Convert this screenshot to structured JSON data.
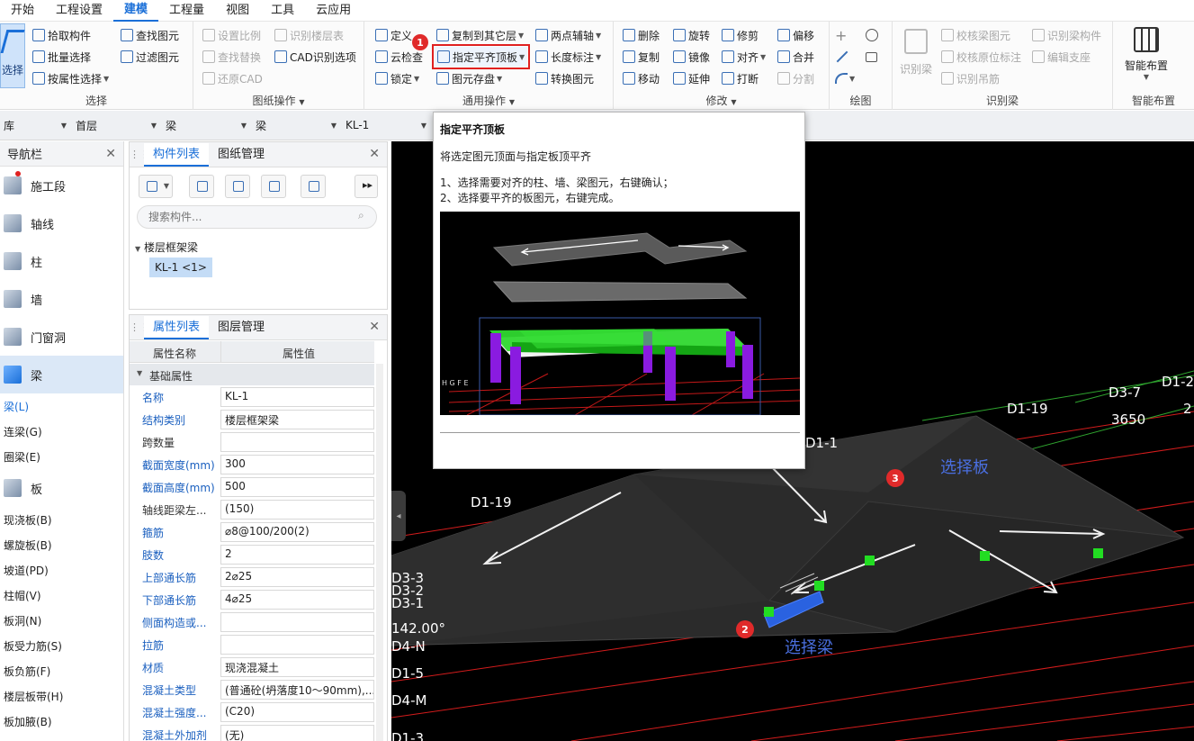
{
  "menu": [
    "开始",
    "工程设置",
    "建模",
    "工程量",
    "视图",
    "工具",
    "云应用"
  ],
  "menu_active": "建模",
  "ribbon": {
    "select_group": {
      "select": "选择",
      "pick": "拾取构件",
      "batch": "批量选择",
      "by_attr": "按属性选择",
      "find": "查找图元",
      "filter": "过滤图元",
      "title": "选择"
    },
    "drawing_group": {
      "set_scale": "设置比例",
      "recognize_floor": "识别楼层表",
      "find_replace": "查找替换",
      "cad_options": "CAD识别选项",
      "restore_cad": "还原CAD",
      "title": "图纸操作"
    },
    "common_group": {
      "define": "定义",
      "cloud_check": "云检查",
      "lock": "锁定",
      "copy_to_layer": "复制到其它层",
      "align_top": "指定平齐顶板",
      "element_save": "图元存盘",
      "two_point_axis": "两点辅轴",
      "length_mark": "长度标注",
      "convert": "转换图元",
      "title": "通用操作"
    },
    "modify_group": {
      "delete": "删除",
      "rotate": "旋转",
      "trim": "修剪",
      "offset": "偏移",
      "copy": "复制",
      "mirror": "镜像",
      "align": "对齐",
      "merge": "合并",
      "move": "移动",
      "extend": "延伸",
      "break": "打断",
      "split": "分割",
      "title": "修改"
    },
    "draw_group": {
      "title": "绘图"
    },
    "recognize_beam_group": {
      "recognize_beam": "识别梁",
      "check_beam": "校核梁图元",
      "recognize_beam_member": "识别梁构件",
      "check_origin": "校核原位标注",
      "edit_support": "编辑支座",
      "recognize_hanger": "识别吊筋",
      "title": "识别梁"
    },
    "smart_group": {
      "smart_layout": "智能布置",
      "title": "智能布置"
    }
  },
  "badges": {
    "one": "1",
    "two": "2",
    "three": "3"
  },
  "selectors": {
    "lib": "库",
    "floor": "首层",
    "cat1": "梁",
    "cat2": "梁",
    "comp": "KL-1"
  },
  "nav": {
    "title": "导航栏",
    "categories": [
      {
        "label": "施工段"
      },
      {
        "label": "轴线"
      },
      {
        "label": "柱"
      },
      {
        "label": "墙"
      },
      {
        "label": "门窗洞"
      },
      {
        "label": "梁"
      }
    ],
    "beam_subs": [
      "梁(L)",
      "连梁(G)",
      "圈梁(E)"
    ],
    "slab": "板",
    "slab_subs": [
      "现浇板(B)",
      "螺旋板(B)",
      "坡道(PD)",
      "柱帽(V)",
      "板洞(N)",
      "板受力筋(S)",
      "板负筋(F)",
      "楼层板带(H)",
      "板加腋(B)"
    ]
  },
  "comp_panel": {
    "tab_list": "构件列表",
    "tab_drawing": "图纸管理",
    "search_placeholder": "搜索构件...",
    "tree_root": "楼层框架梁",
    "tree_item": "KL-1 <1>"
  },
  "prop_panel": {
    "tab_attr": "属性列表",
    "tab_layer": "图层管理",
    "col_name": "属性名称",
    "col_value": "属性值",
    "section": "基础属性",
    "rows": [
      {
        "name": "名称",
        "value": "KL-1",
        "blue": true
      },
      {
        "name": "结构类别",
        "value": "楼层框架梁",
        "blue": true
      },
      {
        "name": "跨数量",
        "value": "",
        "blue": false
      },
      {
        "name": "截面宽度(mm)",
        "value": "300",
        "blue": true
      },
      {
        "name": "截面高度(mm)",
        "value": "500",
        "blue": true
      },
      {
        "name": "轴线距梁左...",
        "value": "(150)",
        "blue": false
      },
      {
        "name": "箍筋",
        "value": "⌀8@100/200(2)",
        "blue": true
      },
      {
        "name": "肢数",
        "value": "2",
        "blue": true
      },
      {
        "name": "上部通长筋",
        "value": "2⌀25",
        "blue": true
      },
      {
        "name": "下部通长筋",
        "value": "4⌀25",
        "blue": true
      },
      {
        "name": "侧面构造或...",
        "value": "",
        "blue": true
      },
      {
        "name": "拉筋",
        "value": "",
        "blue": true
      },
      {
        "name": "材质",
        "value": "现浇混凝土",
        "blue": true
      },
      {
        "name": "混凝土类型",
        "value": "(普通砼(坍落度10～90mm),...",
        "blue": true
      },
      {
        "name": "混凝土强度...",
        "value": "(C20)",
        "blue": true
      },
      {
        "name": "混凝土外加剂",
        "value": "(无)",
        "blue": true
      }
    ]
  },
  "tooltip": {
    "title": "指定平齐顶板",
    "desc": "将选定图元顶面与指定板顶平齐",
    "step1": "1、选择需要对齐的柱、墙、梁图元，右键确认；",
    "step2": "2、选择要平齐的板图元，右键完成。",
    "grid_letters": "H G F E"
  },
  "canvas": {
    "annot_slab": "选择板",
    "annot_beam": "选择梁",
    "labels": [
      "D1-19",
      "D3-7",
      "D1-2",
      "3650",
      "D1-19",
      "D1-1",
      "D3-3",
      "D3-2",
      "D3-1",
      "142.00°",
      "D4-N",
      "D1-5",
      "D4-M",
      "D1-3",
      "2"
    ]
  },
  "colors": {
    "accent": "#1a6fd8",
    "badge": "#e02a2a",
    "annot": "#4a6fe0",
    "beam": "#2a62e0",
    "green": "#22dd22"
  }
}
